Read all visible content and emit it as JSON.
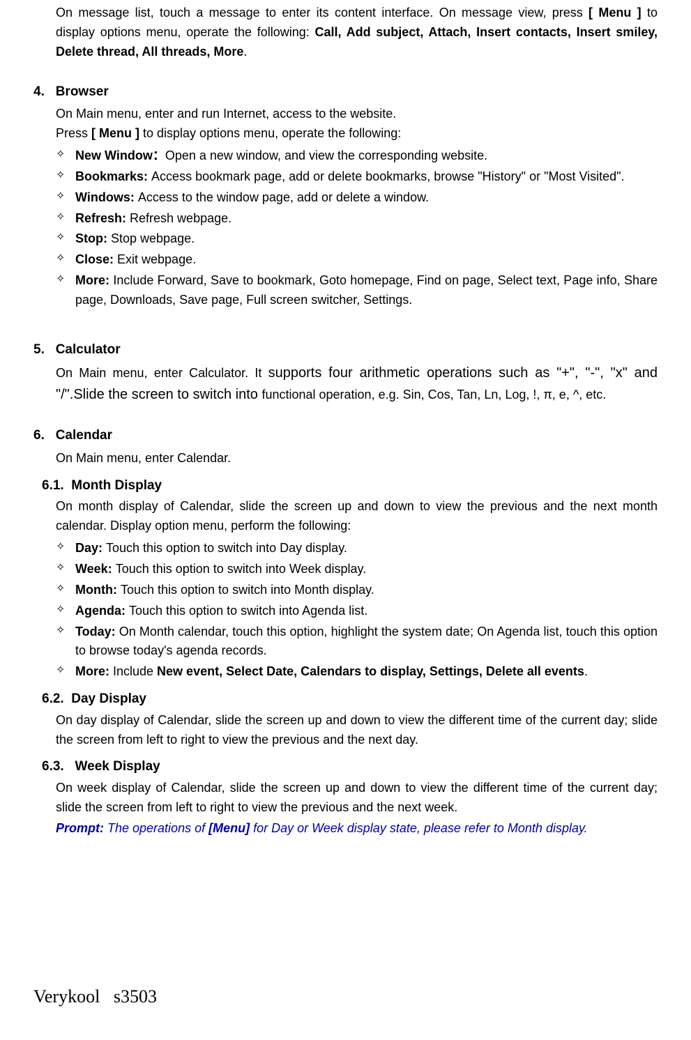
{
  "intro": {
    "p1_a": "On message list, touch a message to enter its content interface. On message view, press ",
    "p1_b": "[ Menu ]",
    "p1_c": " to display options menu, operate the following: ",
    "p1_d": "Call, Add subject, Attach, Insert contacts, Insert smiley, Delete thread, All threads, More",
    "p1_e": "."
  },
  "s4": {
    "num": "4.",
    "title": "Browser",
    "p1": "On Main menu, enter and run Internet, access to the website.",
    "p2_a": "Press ",
    "p2_b": "[ Menu ]",
    "p2_c": " to display options menu, operate the following:",
    "items": [
      {
        "label": "New Window：",
        "text": "Open a new window, and view the corresponding website."
      },
      {
        "label": "Bookmarks: ",
        "text": "Access bookmark page, add or delete bookmarks, browse \"History\" or \"Most Visited\"."
      },
      {
        "label": "Windows: ",
        "text": "Access to the window page, add or delete a window."
      },
      {
        "label": "Refresh: ",
        "text": "Refresh webpage."
      },
      {
        "label": "Stop: ",
        "text": "Stop webpage."
      },
      {
        "label": "Close: ",
        "text": "Exit webpage."
      },
      {
        "label": "More: ",
        "text": "Include Forward, Save to bookmark, Goto homepage, Find on page, Select text, Page info, Share page, Downloads, Save page, Full screen switcher, Settings."
      }
    ]
  },
  "s5": {
    "num": "5.",
    "title": "Calculator",
    "p1_a": "On Main menu, enter Calculator. It ",
    "p1_b": "supports four arithmetic operations such as \"+\", \"-\", \"x\" and \"/\".Slide the screen to switch into ",
    "p1_c": "functional operation, e.g. Sin, Cos, Tan, Ln, Log, !, π, e, ^, etc."
  },
  "s6": {
    "num": "6.",
    "title": "Calendar",
    "p1": "On Main menu, enter Calendar.",
    "sub1": {
      "num": "6.1.",
      "title": "Month Display",
      "p1": "On month display of Calendar, slide the screen up and down to view the previous and the next month calendar. Display option menu, perform the following:",
      "items": [
        {
          "label": "Day: ",
          "text": "Touch this option to switch into Day display."
        },
        {
          "label": "Week: ",
          "text": "Touch this option to switch into Week display."
        },
        {
          "label": "Month: ",
          "text": "Touch this option to switch into Month display."
        },
        {
          "label": "Agenda: ",
          "text": "Touch this option to switch into Agenda list."
        },
        {
          "label": "Today: ",
          "text": "On Month calendar, touch this option, highlight the system date; On Agenda list, touch this option to browse today's agenda records."
        },
        {
          "label": "More: ",
          "text_a": "Include ",
          "text_bold": "New event, Select Date, Calendars to display, Settings, Delete all events",
          "text_b": "."
        }
      ]
    },
    "sub2": {
      "num": "6.2.",
      "title": "Day Display",
      "p1": "On day display of Calendar, slide the screen up and down to view the different time of the current day; slide the screen from left to right to view the previous and the next day."
    },
    "sub3": {
      "num": "6.3.",
      "title": "Week Display",
      "p1": "On week display of Calendar, slide the screen up and down to view the different time of the current day; slide the screen from left to right to view the previous and the next week."
    },
    "prompt_a": "Prompt: ",
    "prompt_b": "The operations of ",
    "prompt_c": "[Menu]",
    "prompt_d": " for Day or Week display state, please refer to Month display."
  },
  "footer": {
    "brand": "Verykool",
    "model": "s3503"
  }
}
